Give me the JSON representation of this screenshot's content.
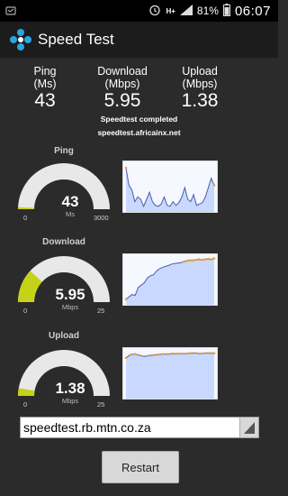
{
  "status_bar": {
    "battery": "81%",
    "network": "H+",
    "clock": "06:07"
  },
  "app": {
    "title": "Speed Test"
  },
  "stats": {
    "ping": {
      "label1": "Ping",
      "label2": "(Ms)",
      "value": "43"
    },
    "download": {
      "label1": "Download",
      "label2": "(Mbps)",
      "value": "5.95"
    },
    "upload": {
      "label1": "Upload",
      "label2": "(Mbps)",
      "value": "1.38"
    }
  },
  "status": {
    "message": "Speedtest completed",
    "server": "speedtest.africainx.net"
  },
  "gauges": {
    "ping": {
      "title": "Ping",
      "value": "43",
      "unit": "Ms",
      "min": "0",
      "max": "3000",
      "fraction": 0.014
    },
    "download": {
      "title": "Download",
      "value": "5.95",
      "unit": "Mbps",
      "min": "0",
      "max": "25",
      "fraction": 0.238
    },
    "upload": {
      "title": "Upload",
      "value": "1.38",
      "unit": "Mbps",
      "min": "0",
      "max": "25",
      "fraction": 0.055
    }
  },
  "graphs": {
    "ping": [
      0.92,
      0.55,
      0.45,
      0.2,
      0.3,
      0.25,
      0.1,
      0.25,
      0.4,
      0.2,
      0.12,
      0.1,
      0.15,
      0.3,
      0.12,
      0.1,
      0.2,
      0.12,
      0.18,
      0.3,
      0.5,
      0.25,
      0.2,
      0.35,
      0.12,
      0.15,
      0.18,
      0.3,
      0.5,
      0.7,
      0.55
    ],
    "download": [
      0.1,
      0.15,
      0.2,
      0.18,
      0.35,
      0.4,
      0.45,
      0.55,
      0.6,
      0.62,
      0.7,
      0.75,
      0.78,
      0.8,
      0.82,
      0.85,
      0.86,
      0.87,
      0.88,
      0.9,
      0.92,
      0.93,
      0.93,
      0.94,
      0.95,
      0.94,
      0.95,
      0.96,
      0.95,
      0.97
    ],
    "upload": [
      0.85,
      0.92,
      0.93,
      0.9,
      0.88,
      0.9,
      0.91,
      0.92,
      0.93,
      0.93,
      0.94,
      0.94,
      0.94,
      0.94,
      0.95,
      0.95,
      0.94,
      0.95,
      0.95,
      0.95
    ]
  },
  "server_input": {
    "value": "speedtest.rb.mtn.co.za"
  },
  "restart_button": {
    "label": "Restart"
  },
  "colors": {
    "gauge_track": "#e8e8e8",
    "gauge_fill": "#c5d318",
    "graph_fill": "#c8d8ff",
    "graph_line": "#4a5ea8",
    "graph_marker": "#f0a030"
  }
}
